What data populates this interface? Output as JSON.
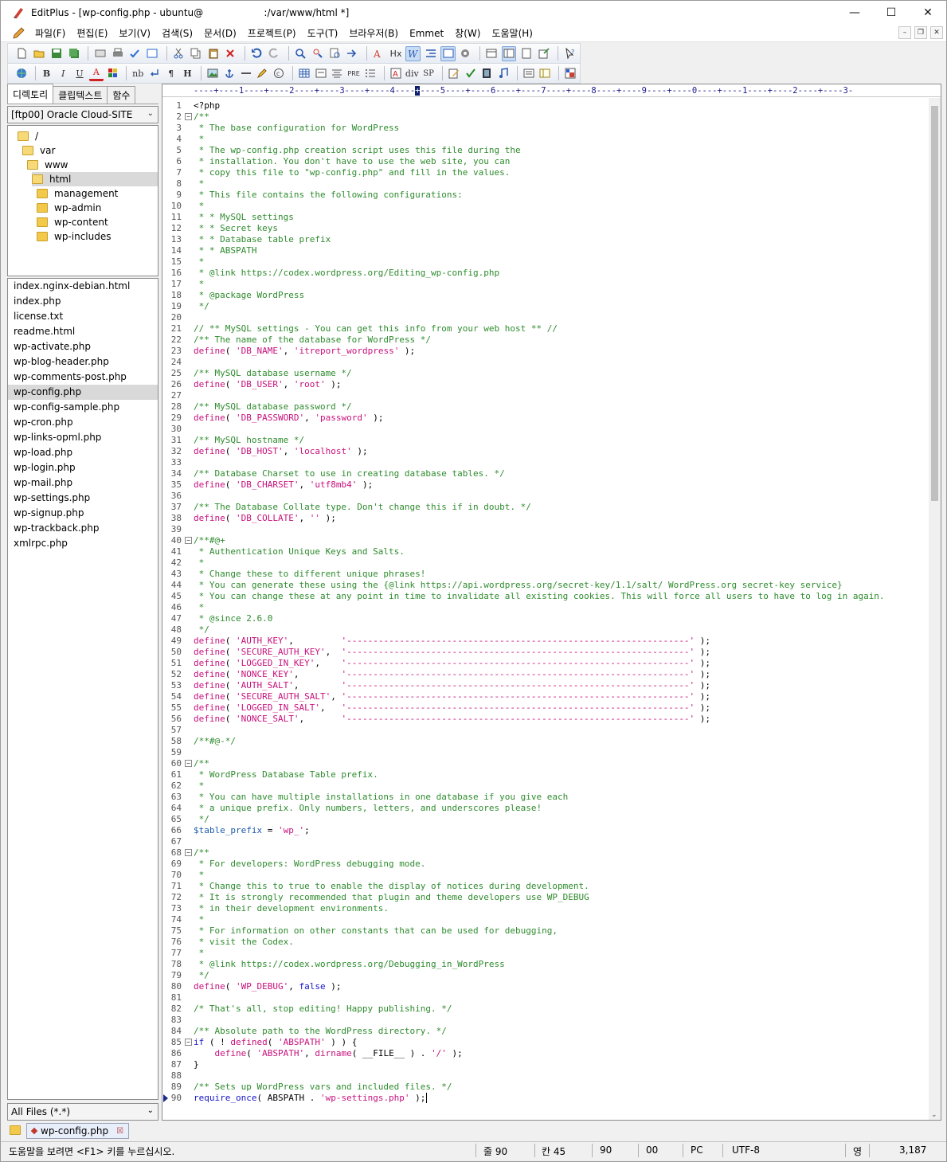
{
  "window": {
    "title": "EditPlus - [wp-config.php - ubuntu@                    :/var/www/html *]"
  },
  "menu": [
    "파일(F)",
    "편집(E)",
    "보기(V)",
    "검색(S)",
    "문서(D)",
    "프로젝트(P)",
    "도구(T)",
    "브라우저(B)",
    "Emmet",
    "창(W)",
    "도움말(H)"
  ],
  "toolbar2_text": {
    "bold": "B",
    "italic": "I",
    "underline": "U",
    "font": "A",
    "nb": "nb",
    "para": "¶",
    "h": "H",
    "div": "div",
    "sp": "SP",
    "pre": "PRE",
    "hx": "Hx"
  },
  "left": {
    "tabs": [
      "디렉토리",
      "클립텍스트",
      "함수"
    ],
    "drive": "[ftp00] Oracle Cloud-SITE",
    "tree": [
      {
        "label": "/",
        "indent": 0,
        "open": true
      },
      {
        "label": "var",
        "indent": 1,
        "open": true
      },
      {
        "label": "www",
        "indent": 2,
        "open": true
      },
      {
        "label": "html",
        "indent": 3,
        "open": true,
        "selected": true
      },
      {
        "label": "management",
        "indent": 4
      },
      {
        "label": "wp-admin",
        "indent": 4
      },
      {
        "label": "wp-content",
        "indent": 4
      },
      {
        "label": "wp-includes",
        "indent": 4
      }
    ],
    "files": [
      "index.nginx-debian.html",
      "index.php",
      "license.txt",
      "readme.html",
      "wp-activate.php",
      "wp-blog-header.php",
      "wp-comments-post.php",
      "wp-config.php",
      "wp-config-sample.php",
      "wp-cron.php",
      "wp-links-opml.php",
      "wp-load.php",
      "wp-login.php",
      "wp-mail.php",
      "wp-settings.php",
      "wp-signup.php",
      "wp-trackback.php",
      "xmlrpc.php"
    ],
    "selected_file": "wp-config.php",
    "filter": "All Files (*.*)"
  },
  "ruler": {
    "before": "----+----1----+----2----+----3----+----4----",
    "cursor": "+",
    "after": "----5----+----6----+----7----+----8----+----9----+----0----+----1----+----2----+----3-"
  },
  "code": [
    {
      "n": 1,
      "segs": [
        [
          "p",
          "<?php"
        ]
      ]
    },
    {
      "n": 2,
      "fold": true,
      "segs": [
        [
          "c",
          "/**"
        ]
      ]
    },
    {
      "n": 3,
      "segs": [
        [
          "c",
          " * The base configuration for WordPress"
        ]
      ]
    },
    {
      "n": 4,
      "segs": [
        [
          "c",
          " *"
        ]
      ]
    },
    {
      "n": 5,
      "segs": [
        [
          "c",
          " * The wp-config.php creation script uses this file during the"
        ]
      ]
    },
    {
      "n": 6,
      "segs": [
        [
          "c",
          " * installation. You don't have to use the web site, you can"
        ]
      ]
    },
    {
      "n": 7,
      "segs": [
        [
          "c",
          " * copy this file to \"wp-config.php\" and fill in the values."
        ]
      ]
    },
    {
      "n": 8,
      "segs": [
        [
          "c",
          " *"
        ]
      ]
    },
    {
      "n": 9,
      "segs": [
        [
          "c",
          " * This file contains the following configurations:"
        ]
      ]
    },
    {
      "n": 10,
      "segs": [
        [
          "c",
          " *"
        ]
      ]
    },
    {
      "n": 11,
      "segs": [
        [
          "c",
          " * * MySQL settings"
        ]
      ]
    },
    {
      "n": 12,
      "segs": [
        [
          "c",
          " * * Secret keys"
        ]
      ]
    },
    {
      "n": 13,
      "segs": [
        [
          "c",
          " * * Database table prefix"
        ]
      ]
    },
    {
      "n": 14,
      "segs": [
        [
          "c",
          " * * ABSPATH"
        ]
      ]
    },
    {
      "n": 15,
      "segs": [
        [
          "c",
          " *"
        ]
      ]
    },
    {
      "n": 16,
      "segs": [
        [
          "c",
          " * @link https://codex.wordpress.org/Editing_wp-config.php"
        ]
      ]
    },
    {
      "n": 17,
      "segs": [
        [
          "c",
          " *"
        ]
      ]
    },
    {
      "n": 18,
      "segs": [
        [
          "c",
          " * @package WordPress"
        ]
      ]
    },
    {
      "n": 19,
      "segs": [
        [
          "c",
          " */"
        ]
      ]
    },
    {
      "n": 20,
      "segs": []
    },
    {
      "n": 21,
      "segs": [
        [
          "c",
          "// ** MySQL settings - You can get this info from your web host ** //"
        ]
      ]
    },
    {
      "n": 22,
      "segs": [
        [
          "c",
          "/** The name of the database for WordPress */"
        ]
      ]
    },
    {
      "n": 23,
      "segs": [
        [
          "s",
          "define"
        ],
        [
          "p",
          "( "
        ],
        [
          "s",
          "'DB_NAME'"
        ],
        [
          "p",
          ", "
        ],
        [
          "s",
          "'itreport_wordpress'"
        ],
        [
          "p",
          " );"
        ]
      ]
    },
    {
      "n": 24,
      "segs": []
    },
    {
      "n": 25,
      "segs": [
        [
          "c",
          "/** MySQL database username */"
        ]
      ]
    },
    {
      "n": 26,
      "segs": [
        [
          "s",
          "define"
        ],
        [
          "p",
          "( "
        ],
        [
          "s",
          "'DB_USER'"
        ],
        [
          "p",
          ", "
        ],
        [
          "s",
          "'root'"
        ],
        [
          "p",
          " );"
        ]
      ]
    },
    {
      "n": 27,
      "segs": []
    },
    {
      "n": 28,
      "segs": [
        [
          "c",
          "/** MySQL database password */"
        ]
      ]
    },
    {
      "n": 29,
      "segs": [
        [
          "s",
          "define"
        ],
        [
          "p",
          "( "
        ],
        [
          "s",
          "'DB_PASSWORD'"
        ],
        [
          "p",
          ", "
        ],
        [
          "s",
          "'password'"
        ],
        [
          "p",
          " );"
        ]
      ]
    },
    {
      "n": 30,
      "segs": []
    },
    {
      "n": 31,
      "segs": [
        [
          "c",
          "/** MySQL hostname */"
        ]
      ]
    },
    {
      "n": 32,
      "segs": [
        [
          "s",
          "define"
        ],
        [
          "p",
          "( "
        ],
        [
          "s",
          "'DB_HOST'"
        ],
        [
          "p",
          ", "
        ],
        [
          "s",
          "'localhost'"
        ],
        [
          "p",
          " );"
        ]
      ]
    },
    {
      "n": 33,
      "segs": []
    },
    {
      "n": 34,
      "segs": [
        [
          "c",
          "/** Database Charset to use in creating database tables. */"
        ]
      ]
    },
    {
      "n": 35,
      "segs": [
        [
          "s",
          "define"
        ],
        [
          "p",
          "( "
        ],
        [
          "s",
          "'DB_CHARSET'"
        ],
        [
          "p",
          ", "
        ],
        [
          "s",
          "'utf8mb4'"
        ],
        [
          "p",
          " );"
        ]
      ]
    },
    {
      "n": 36,
      "segs": []
    },
    {
      "n": 37,
      "segs": [
        [
          "c",
          "/** The Database Collate type. Don't change this if in doubt. */"
        ]
      ]
    },
    {
      "n": 38,
      "segs": [
        [
          "s",
          "define"
        ],
        [
          "p",
          "( "
        ],
        [
          "s",
          "'DB_COLLATE'"
        ],
        [
          "p",
          ", "
        ],
        [
          "s",
          "''"
        ],
        [
          "p",
          " );"
        ]
      ]
    },
    {
      "n": 39,
      "segs": []
    },
    {
      "n": 40,
      "fold": true,
      "segs": [
        [
          "c",
          "/**#@+"
        ]
      ]
    },
    {
      "n": 41,
      "segs": [
        [
          "c",
          " * Authentication Unique Keys and Salts."
        ]
      ]
    },
    {
      "n": 42,
      "segs": [
        [
          "c",
          " *"
        ]
      ]
    },
    {
      "n": 43,
      "segs": [
        [
          "c",
          " * Change these to different unique phrases!"
        ]
      ]
    },
    {
      "n": 44,
      "segs": [
        [
          "c",
          " * You can generate these using the {@link https://api.wordpress.org/secret-key/1.1/salt/ WordPress.org secret-key service}"
        ]
      ]
    },
    {
      "n": 45,
      "segs": [
        [
          "c",
          " * You can change these at any point in time to invalidate all existing cookies. This will force all users to have to log in again."
        ]
      ]
    },
    {
      "n": 46,
      "segs": [
        [
          "c",
          " *"
        ]
      ]
    },
    {
      "n": 47,
      "segs": [
        [
          "c",
          " * @since 2.6.0"
        ]
      ]
    },
    {
      "n": 48,
      "segs": [
        [
          "c",
          " */"
        ]
      ]
    },
    {
      "n": 49,
      "segs": [
        [
          "s",
          "define"
        ],
        [
          "p",
          "( "
        ],
        [
          "s",
          "'AUTH_KEY'"
        ],
        [
          "p",
          ",         "
        ],
        [
          "s",
          "'-----------------------------------------------------------------'"
        ],
        [
          "p",
          " );"
        ]
      ]
    },
    {
      "n": 50,
      "segs": [
        [
          "s",
          "define"
        ],
        [
          "p",
          "( "
        ],
        [
          "s",
          "'SECURE_AUTH_KEY'"
        ],
        [
          "p",
          ",  "
        ],
        [
          "s",
          "'-----------------------------------------------------------------'"
        ],
        [
          "p",
          " );"
        ]
      ]
    },
    {
      "n": 51,
      "segs": [
        [
          "s",
          "define"
        ],
        [
          "p",
          "( "
        ],
        [
          "s",
          "'LOGGED_IN_KEY'"
        ],
        [
          "p",
          ",    "
        ],
        [
          "s",
          "'-----------------------------------------------------------------'"
        ],
        [
          "p",
          " );"
        ]
      ]
    },
    {
      "n": 52,
      "segs": [
        [
          "s",
          "define"
        ],
        [
          "p",
          "( "
        ],
        [
          "s",
          "'NONCE_KEY'"
        ],
        [
          "p",
          ",        "
        ],
        [
          "s",
          "'-----------------------------------------------------------------'"
        ],
        [
          "p",
          " );"
        ]
      ]
    },
    {
      "n": 53,
      "segs": [
        [
          "s",
          "define"
        ],
        [
          "p",
          "( "
        ],
        [
          "s",
          "'AUTH_SALT'"
        ],
        [
          "p",
          ",        "
        ],
        [
          "s",
          "'-----------------------------------------------------------------'"
        ],
        [
          "p",
          " );"
        ]
      ]
    },
    {
      "n": 54,
      "segs": [
        [
          "s",
          "define"
        ],
        [
          "p",
          "( "
        ],
        [
          "s",
          "'SECURE_AUTH_SALT'"
        ],
        [
          "p",
          ", "
        ],
        [
          "s",
          "'-----------------------------------------------------------------'"
        ],
        [
          "p",
          " );"
        ]
      ]
    },
    {
      "n": 55,
      "segs": [
        [
          "s",
          "define"
        ],
        [
          "p",
          "( "
        ],
        [
          "s",
          "'LOGGED_IN_SALT'"
        ],
        [
          "p",
          ",   "
        ],
        [
          "s",
          "'-----------------------------------------------------------------'"
        ],
        [
          "p",
          " );"
        ]
      ]
    },
    {
      "n": 56,
      "segs": [
        [
          "s",
          "define"
        ],
        [
          "p",
          "( "
        ],
        [
          "s",
          "'NONCE_SALT'"
        ],
        [
          "p",
          ",       "
        ],
        [
          "s",
          "'-----------------------------------------------------------------'"
        ],
        [
          "p",
          " );"
        ]
      ]
    },
    {
      "n": 57,
      "segs": []
    },
    {
      "n": 58,
      "segs": [
        [
          "c",
          "/**#@-*/"
        ]
      ]
    },
    {
      "n": 59,
      "segs": []
    },
    {
      "n": 60,
      "fold": true,
      "segs": [
        [
          "c",
          "/**"
        ]
      ]
    },
    {
      "n": 61,
      "segs": [
        [
          "c",
          " * WordPress Database Table prefix."
        ]
      ]
    },
    {
      "n": 62,
      "segs": [
        [
          "c",
          " *"
        ]
      ]
    },
    {
      "n": 63,
      "segs": [
        [
          "c",
          " * You can have multiple installations in one database if you give each"
        ]
      ]
    },
    {
      "n": 64,
      "segs": [
        [
          "c",
          " * a unique prefix. Only numbers, letters, and underscores please!"
        ]
      ]
    },
    {
      "n": 65,
      "segs": [
        [
          "c",
          " */"
        ]
      ]
    },
    {
      "n": 66,
      "segs": [
        [
          "v",
          "$table_prefix"
        ],
        [
          "p",
          " = "
        ],
        [
          "s",
          "'wp_'"
        ],
        [
          "p",
          ";"
        ]
      ]
    },
    {
      "n": 67,
      "segs": []
    },
    {
      "n": 68,
      "fold": true,
      "segs": [
        [
          "c",
          "/**"
        ]
      ]
    },
    {
      "n": 69,
      "segs": [
        [
          "c",
          " * For developers: WordPress debugging mode."
        ]
      ]
    },
    {
      "n": 70,
      "segs": [
        [
          "c",
          " *"
        ]
      ]
    },
    {
      "n": 71,
      "segs": [
        [
          "c",
          " * Change this to true to enable the display of notices during development."
        ]
      ]
    },
    {
      "n": 72,
      "segs": [
        [
          "c",
          " * It is strongly recommended that plugin and theme developers use WP_DEBUG"
        ]
      ]
    },
    {
      "n": 73,
      "segs": [
        [
          "c",
          " * in their development environments."
        ]
      ]
    },
    {
      "n": 74,
      "segs": [
        [
          "c",
          " *"
        ]
      ]
    },
    {
      "n": 75,
      "segs": [
        [
          "c",
          " * For information on other constants that can be used for debugging,"
        ]
      ]
    },
    {
      "n": 76,
      "segs": [
        [
          "c",
          " * visit the Codex."
        ]
      ]
    },
    {
      "n": 77,
      "segs": [
        [
          "c",
          " *"
        ]
      ]
    },
    {
      "n": 78,
      "segs": [
        [
          "c",
          " * @link https://codex.wordpress.org/Debugging_in_WordPress"
        ]
      ]
    },
    {
      "n": 79,
      "segs": [
        [
          "c",
          " */"
        ]
      ]
    },
    {
      "n": 80,
      "segs": [
        [
          "s",
          "define"
        ],
        [
          "p",
          "( "
        ],
        [
          "s",
          "'WP_DEBUG'"
        ],
        [
          "p",
          ", "
        ],
        [
          "k",
          "false"
        ],
        [
          "p",
          " );"
        ]
      ]
    },
    {
      "n": 81,
      "segs": []
    },
    {
      "n": 82,
      "segs": [
        [
          "c",
          "/* That's all, stop editing! Happy publishing. */"
        ]
      ]
    },
    {
      "n": 83,
      "segs": []
    },
    {
      "n": 84,
      "segs": [
        [
          "c",
          "/** Absolute path to the WordPress directory. */"
        ]
      ]
    },
    {
      "n": 85,
      "fold": true,
      "segs": [
        [
          "k",
          "if"
        ],
        [
          "p",
          " ( ! "
        ],
        [
          "s",
          "defined"
        ],
        [
          "p",
          "( "
        ],
        [
          "s",
          "'ABSPATH'"
        ],
        [
          "p",
          " ) ) {"
        ]
      ]
    },
    {
      "n": 86,
      "segs": [
        [
          "p",
          "    "
        ],
        [
          "s",
          "define"
        ],
        [
          "p",
          "( "
        ],
        [
          "s",
          "'ABSPATH'"
        ],
        [
          "p",
          ", "
        ],
        [
          "s",
          "dirname"
        ],
        [
          "p",
          "( __FILE__ ) . "
        ],
        [
          "s",
          "'/'"
        ],
        [
          "p",
          " );"
        ]
      ]
    },
    {
      "n": 87,
      "segs": [
        [
          "p",
          "}"
        ]
      ]
    },
    {
      "n": 88,
      "segs": []
    },
    {
      "n": 89,
      "segs": [
        [
          "c",
          "/** Sets up WordPress vars and included files. */"
        ]
      ]
    },
    {
      "n": 90,
      "current": true,
      "segs": [
        [
          "k",
          "require_once"
        ],
        [
          "p",
          "( ABSPATH . "
        ],
        [
          "s",
          "'wp-settings.php'"
        ],
        [
          "p",
          " );"
        ]
      ]
    }
  ],
  "doc_tab": "wp-config.php",
  "status": {
    "help": "도움말을 보려면 <F1> 키를 누르십시오.",
    "line": "줄 90",
    "col": "칸 45",
    "total": "90",
    "ovr": "00",
    "eol": "PC",
    "enc": "UTF-8",
    "ime": "영",
    "size": "3,187"
  },
  "colors": {
    "comment": "#2e8b2e",
    "string": "#c8107c",
    "keyword": "#1515c8",
    "variable": "#1a5aa8"
  }
}
